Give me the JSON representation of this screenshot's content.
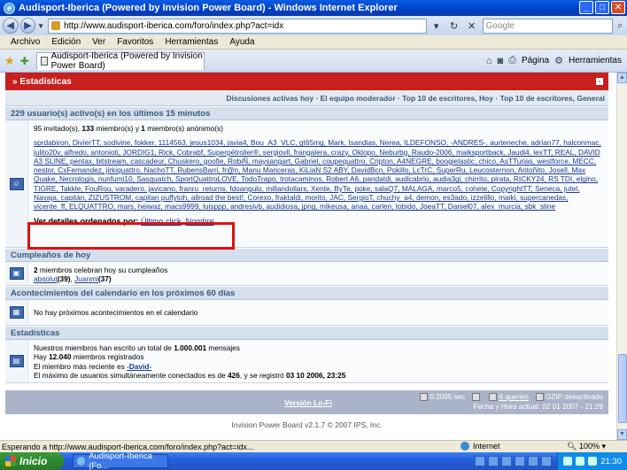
{
  "window": {
    "title": "Audisport-Iberica (Powered by Invision Power Board) - Windows Internet Explorer",
    "min_label": "_",
    "max_label": "□",
    "close_label": "✕"
  },
  "browser": {
    "url": "http://www.audisport-iberica.com/foro/index.php?act=idx",
    "search_placeholder": "Google",
    "menu": [
      "Archivo",
      "Edición",
      "Ver",
      "Favoritos",
      "Herramientas",
      "Ayuda"
    ],
    "tab_title": "Audisport-Iberica (Powered by Invision Power Board)",
    "cmd_page": "Página",
    "cmd_tools": "Herramientas",
    "status_text": "Esperando a http://www.audisport-iberica.com/foro/index.php?act=idx...",
    "zone": "Internet",
    "zoom": "100%"
  },
  "forum": {
    "stats_header": "Estadísticas",
    "collapse_label": "-",
    "subnav": "Discusiones activas hoy · El equipo moderador · Top 10 de escritores, Hoy · Top 10 de escritores, General",
    "online": {
      "title": "229 usuario(s) activo(s) en los últimos 15 minutos",
      "summary_pre": "95 invitado(s), ",
      "members_count": "133",
      "summary_mid": " miembro(s) y ",
      "anon_count": "1",
      "summary_post": " miembro(s) anónimo(s)",
      "users": "sprdabiron, DivierTT, sodivine, fokker, 1114563, jesus1034, javia4, Bou_A3_VLC, gt65mg, Mark, Isandias, Nerea, ILDEFONSO, -ANDRES-, aurteneche, adrian77, halconmac, julito20v, alfredo, antonioti, JORDIG1, Rick, Cobrabf, Superpétrolier®, sergiovll, frangalera, crazy, Oklopo, Neburbg, Raudo-2006, maiksportback, Jaudi4, lexTT, REAL, DAVID A3 SLINE, pentax, bitstream, cascadeur, Chuskero, goofie, RobiÑ, maysangart, Gabriel, coupequattro, Cripton, A4NEGRE, boogielastic, chico, AsTTurias, westforce, MECC, nestor, CxFernandez, jirkiquattro, NachoTT, RubensBarri, fr@n, Manu Manceras, KiLiaN S2 ABY, DavidBcn, Pokillo, LcTrC, SuperRu, Leucosternon, Antoñito, Josell, Max Quake, Necrologis, nunfumi10, Sasquatch, SportQuattroLOVE, TodoTrapo, trotacaminos, Robert A6, pandatdi, audicabrio, audia3gi, chirrito, pirata, RICKY24, RS TDI, elgino, TIGRE, Takkle, FouRou, varadero, javicano, franru_returns, fdoangulo, millandollars, Xente, ByTe, poke, salaQ7, MALAGA, marco5, cohete, CopyrightTT, Seneca, jutel, Navaja, capitán, ZIZUSTROM, capitan puffytoh, allroad the best!, Corexo, fraktaldi, morito, JAC, SergioT, chuchy_a4, demon, es3ado, izzelillo, maiki, supercanedas, vicente_ff, ELQUATTRO, mars, heiwaz, macs9999, luisppp, andresivb, audidiosa, jpng, mikeusa, anaa, carlen, tobido, JoeaTT, Daniel07, alex_murcia, sbk_sline",
      "details_label": "Ver detalles ordenados por:",
      "sort_last_click": "Último click",
      "sort_separator": ", ",
      "sort_name": "Nombre"
    },
    "birthdays": {
      "title": "Cumpleaños de hoy",
      "count": "2",
      "text": " miembros celebran hoy su cumpleaños",
      "user1": "absolut",
      "age1": "(39)",
      "user2": "Juanmi",
      "age2": "(37)"
    },
    "calendar": {
      "title": "Acontecimientos del calendario en los próximos 60 días",
      "text": "No hay próximos acontecimientos en el calendario"
    },
    "stats": {
      "title": "Estadísticas",
      "line1_pre": "Nuestros miembros han escrito un total de ",
      "total_posts": "1.000.001",
      "line1_post": " mensajes",
      "line2_pre": "Hay ",
      "total_members": "12.040",
      "line2_post": " miembros registrados",
      "line3_pre": "El miembro más reciente es ",
      "newest_member": "-David-",
      "line4_pre": "El máximo de usuarios simultáneamente conectados es de ",
      "max_users": "426",
      "line4_mid": ", y se registró ",
      "max_date": "03 10 2006, 23:25"
    },
    "footer": {
      "version": "Versión Lo-Fi",
      "time": "0.2095 sec",
      "queries": "6 queries",
      "gzip": "GZIP desactivado",
      "datetime": "Fecha y Hora actual: 02 01 2007 - 21:29",
      "copyright": "Invision Power Board v2.1.7 © 2007  IPS, Inc."
    }
  },
  "taskbar": {
    "start": "Inicio",
    "task": "Audisport-Iberica (Fo...",
    "clock": "21:30"
  }
}
